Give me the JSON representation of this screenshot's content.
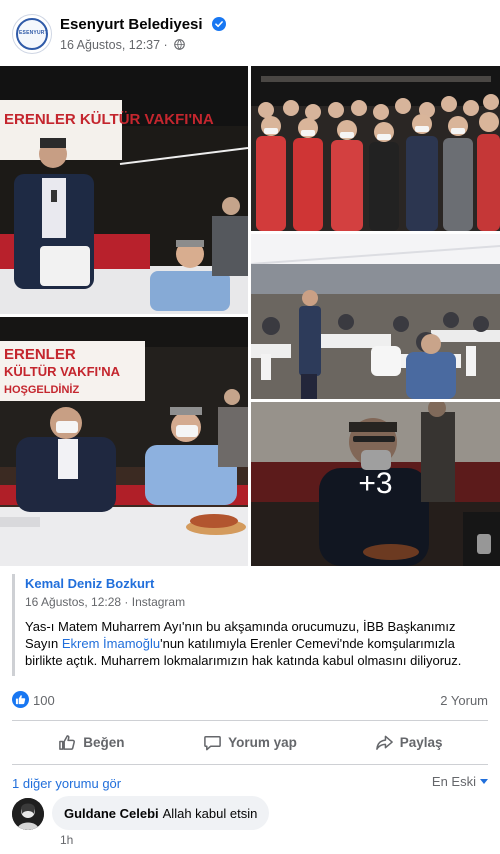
{
  "post": {
    "page_name": "Esenyurt Belediyesi",
    "avatar_logo_text": "ESENYURT",
    "timestamp": "16 Ağustos, 12:37 ·",
    "privacy_icon": "globe-icon",
    "verified_icon": "verified-badge-icon"
  },
  "photos": {
    "more_count": "+3",
    "banner_1": "ERENLER KÜLTÜR VAKFI'NA",
    "banner_4_top": "ERENLER",
    "banner_4_mid": "KÜLTÜR VAKFI'NA",
    "banner_4_bottom": "HOŞGELDİNİZ"
  },
  "shared": {
    "author": "Kemal Deniz Bozkurt",
    "meta": "16 Ağustos, 12:28 · Instagram",
    "text_before_link": "Yas-ı Matem Muharrem Ayı'nın bu akşamında orucumuzu, İBB Başkanımız Sayın ",
    "link_text": "Ekrem İmamoğlu",
    "text_after_link": "'nun katılımıyla Erenler Cemevi'nde komşularımızla birlikte açtık. Muharrem lokmalarımızın hak katında kabul olmasını diliyoruz."
  },
  "reactions": {
    "count": "100",
    "comments": "2 Yorum",
    "like_color": "#1877f2"
  },
  "actions": {
    "like": "Beğen",
    "comment": "Yorum yap",
    "share": "Paylaş"
  },
  "comments": {
    "view_more": "1 diğer yorumu gör",
    "sort": "En Eski",
    "items": [
      {
        "name": "Guldane Celebi",
        "text": "Allah kabul etsin",
        "time": "1h"
      }
    ]
  }
}
